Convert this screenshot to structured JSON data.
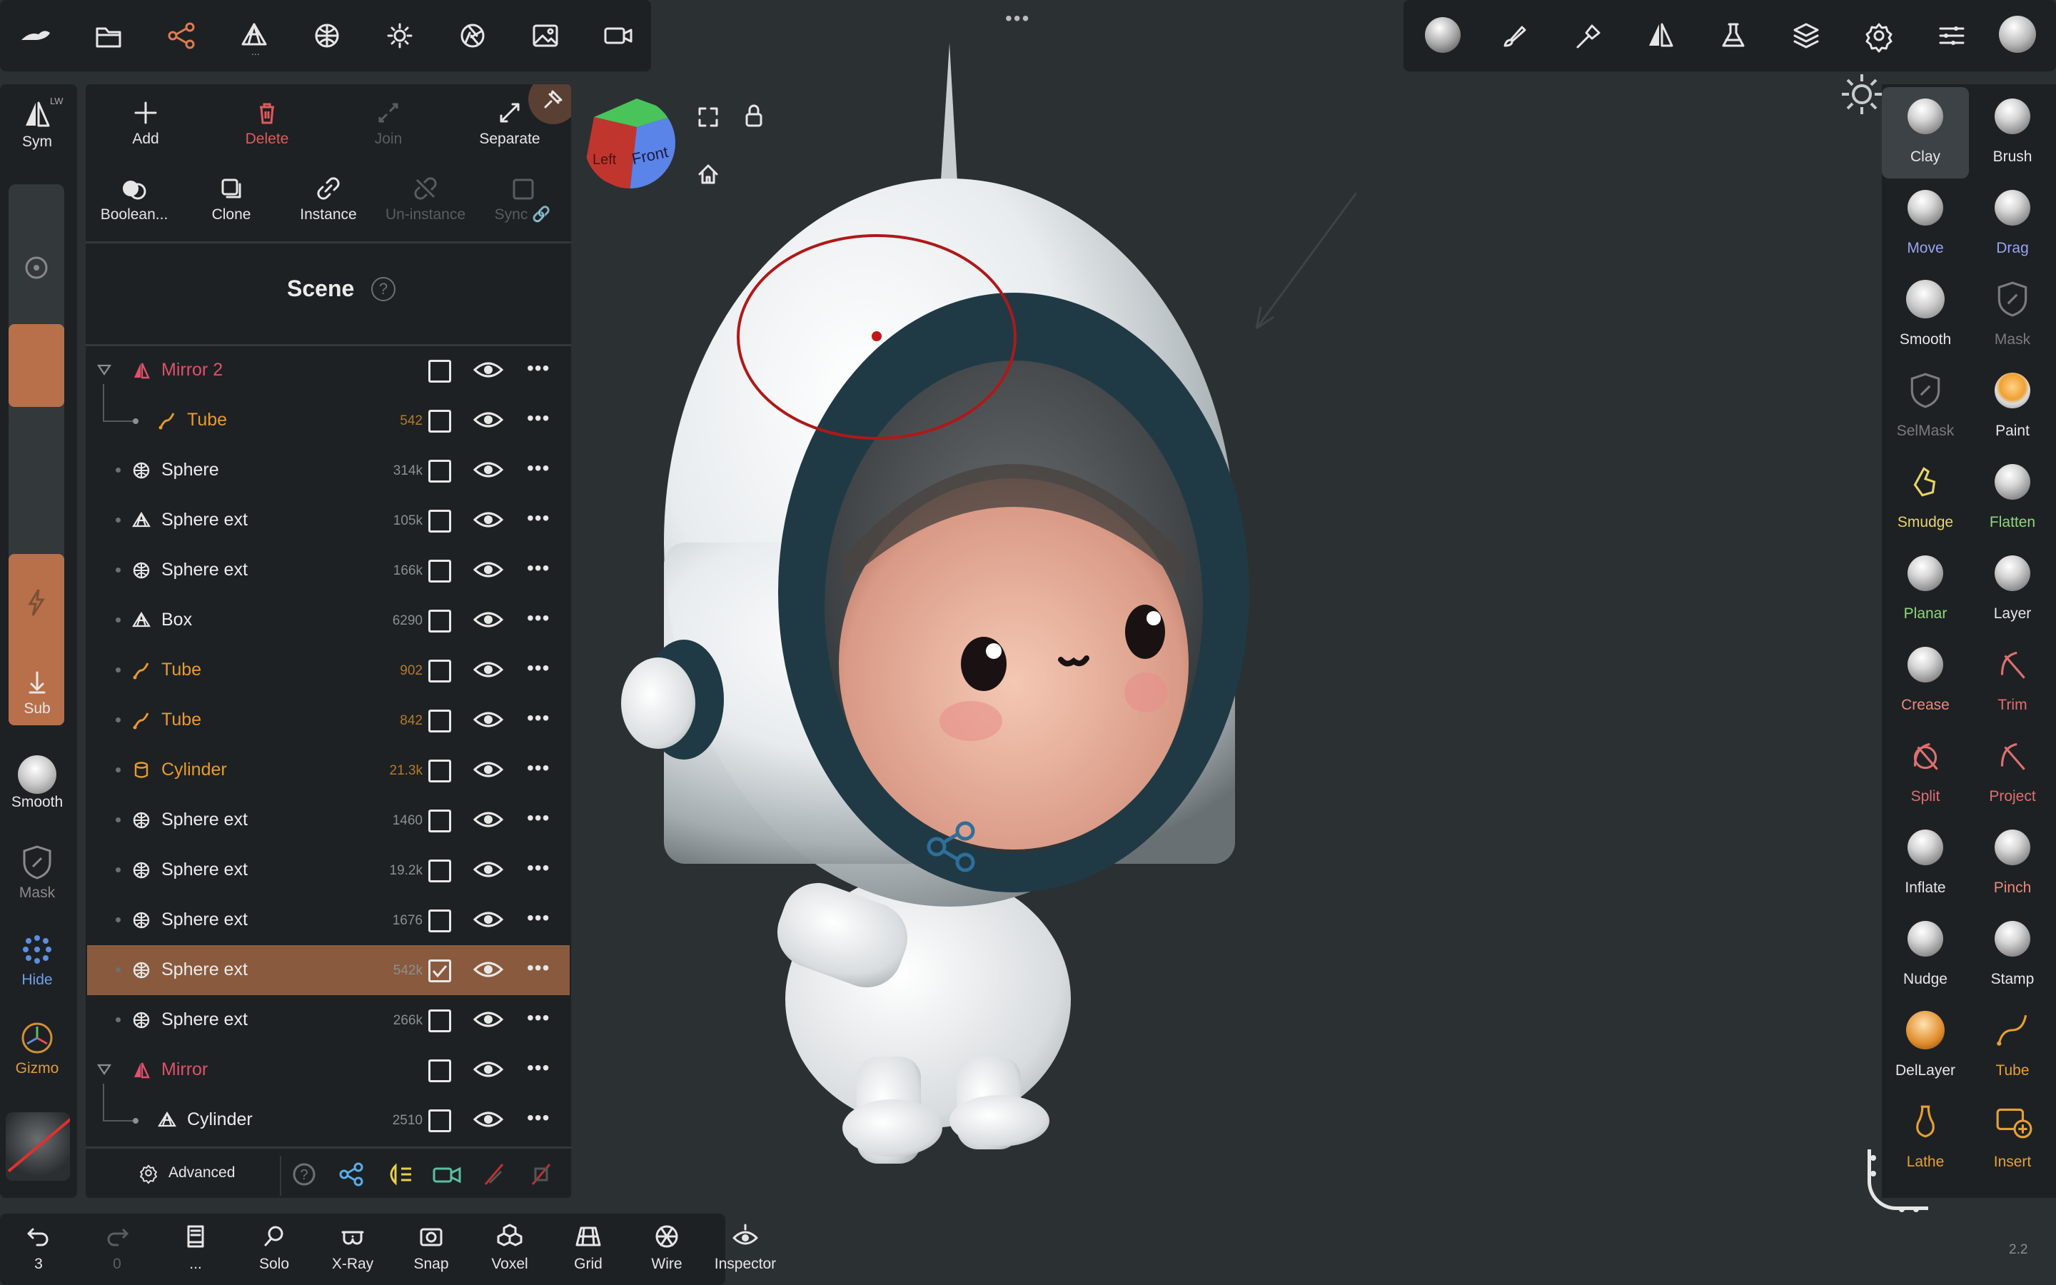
{
  "top_toolbar": {
    "left_icons": [
      "app-logo-icon",
      "folder-icon",
      "scene-graph-icon",
      "topology-icon",
      "material-sphere-icon",
      "light-sun-icon",
      "aperture-icon",
      "image-icon",
      "camera-video-icon"
    ],
    "more_dots": "•••",
    "right_icons": [
      "material-ball-icon",
      "paint-brush-icon",
      "sculpt-brush-icon",
      "symmetry-icon",
      "flask-icon",
      "layers-icon",
      "settings-gear-icon",
      "sliders-icon",
      "sphere-preview-icon"
    ]
  },
  "left_strip": {
    "sym_label": "Sym",
    "sym_sub": "LW",
    "sub_label": "Sub",
    "smooth_label": "Smooth",
    "mask_label": "Mask",
    "hide_label": "Hide",
    "gizmo_label": "Gizmo",
    "swatch_color": "#b8704a"
  },
  "scene_panel": {
    "actions": [
      {
        "label": "Add",
        "icon": "plus-icon",
        "enabled": true
      },
      {
        "label": "Delete",
        "icon": "trash-icon",
        "enabled": true
      },
      {
        "label": "Join",
        "icon": "join-icon",
        "enabled": false
      },
      {
        "label": "Separate",
        "icon": "separate-icon",
        "enabled": true
      },
      {
        "label": "Boolean...",
        "icon": "boolean-icon",
        "enabled": true
      },
      {
        "label": "Clone",
        "icon": "clone-icon",
        "enabled": true
      },
      {
        "label": "Instance",
        "icon": "link-icon",
        "enabled": true
      },
      {
        "label": "Un-instance",
        "icon": "unlink-icon",
        "enabled": false
      },
      {
        "label": "Sync 🔗",
        "icon": "sync-checkbox-icon",
        "enabled": false
      }
    ],
    "title": "Scene",
    "help": "?",
    "rows": [
      {
        "name": "Mirror 2",
        "count": "",
        "kind": "mirror",
        "style": "red",
        "checked": false,
        "indent": 0,
        "expander": true
      },
      {
        "name": "Tube",
        "count": "542",
        "kind": "tube",
        "style": "orange",
        "checked": false,
        "indent": 1
      },
      {
        "name": "Sphere",
        "count": "314k",
        "kind": "sphere",
        "style": "normal",
        "checked": false,
        "indent": 0
      },
      {
        "name": "Sphere ext",
        "count": "105k",
        "kind": "mesh",
        "style": "normal",
        "checked": false,
        "indent": 0
      },
      {
        "name": "Sphere ext",
        "count": "166k",
        "kind": "sphere",
        "style": "normal",
        "checked": false,
        "indent": 0
      },
      {
        "name": "Box",
        "count": "6290",
        "kind": "mesh",
        "style": "normal",
        "checked": false,
        "indent": 0
      },
      {
        "name": "Tube",
        "count": "902",
        "kind": "tube",
        "style": "orange",
        "checked": false,
        "indent": 0
      },
      {
        "name": "Tube",
        "count": "842",
        "kind": "tube",
        "style": "orange",
        "checked": false,
        "indent": 0
      },
      {
        "name": "Cylinder",
        "count": "21.3k",
        "kind": "cylinder",
        "style": "orange",
        "checked": false,
        "indent": 0
      },
      {
        "name": "Sphere ext",
        "count": "1460",
        "kind": "sphere",
        "style": "normal",
        "checked": false,
        "indent": 0
      },
      {
        "name": "Sphere ext",
        "count": "19.2k",
        "kind": "sphere",
        "style": "normal",
        "checked": false,
        "indent": 0
      },
      {
        "name": "Sphere ext",
        "count": "1676",
        "kind": "sphere",
        "style": "normal",
        "checked": false,
        "indent": 0
      },
      {
        "name": "Sphere ext",
        "count": "542k",
        "kind": "sphere",
        "style": "selected",
        "checked": true,
        "indent": 0
      },
      {
        "name": "Sphere ext",
        "count": "266k",
        "kind": "sphere",
        "style": "normal",
        "checked": false,
        "indent": 0
      },
      {
        "name": "Mirror",
        "count": "",
        "kind": "mirror",
        "style": "red",
        "checked": false,
        "indent": 0,
        "expander": true
      },
      {
        "name": "Cylinder",
        "count": "2510",
        "kind": "mesh",
        "style": "normal",
        "checked": false,
        "indent": 1
      }
    ],
    "footer": {
      "advanced_label": "Advanced",
      "icons": [
        "help-circle-icon",
        "share-nodes-icon",
        "light-icon",
        "camera-icon",
        "no-mask-icon",
        "no-brush-icon"
      ]
    }
  },
  "viewport": {
    "cube_labels": {
      "front": "Front",
      "left": "Left"
    },
    "icons": [
      "fullscreen-icon",
      "lock-icon",
      "home-icon",
      "sun-light-icon",
      "share-nodes-icon"
    ],
    "version": "2.2"
  },
  "right_tools": [
    {
      "label": "Clay",
      "color": "#e6e6e6",
      "active": true
    },
    {
      "label": "Brush",
      "color": "#e6e6e6"
    },
    {
      "label": "Move",
      "color": "#9aa2f0"
    },
    {
      "label": "Drag",
      "color": "#9aa2f0"
    },
    {
      "label": "Smooth",
      "color": "#e6e6e6"
    },
    {
      "label": "Mask",
      "color": "#7b7b7b"
    },
    {
      "label": "SelMask",
      "color": "#7b7b7b"
    },
    {
      "label": "Paint",
      "color": "#e6e6e6"
    },
    {
      "label": "Smudge",
      "color": "#e8d468"
    },
    {
      "label": "Flatten",
      "color": "#8fd67b"
    },
    {
      "label": "Planar",
      "color": "#8fd67b"
    },
    {
      "label": "Layer",
      "color": "#e6e6e6"
    },
    {
      "label": "Crease",
      "color": "#e98a7a"
    },
    {
      "label": "Trim",
      "color": "#e06f6f"
    },
    {
      "label": "Split",
      "color": "#e06f6f"
    },
    {
      "label": "Project",
      "color": "#e06f6f"
    },
    {
      "label": "Inflate",
      "color": "#e6e6e6"
    },
    {
      "label": "Pinch",
      "color": "#e98a7a"
    },
    {
      "label": "Nudge",
      "color": "#e6e6e6"
    },
    {
      "label": "Stamp",
      "color": "#e6e6e6"
    },
    {
      "label": "DelLayer",
      "color": "#e6e6e6"
    },
    {
      "label": "Tube",
      "color": "#e8a030"
    },
    {
      "label": "Lathe",
      "color": "#e8a030"
    },
    {
      "label": "Insert",
      "color": "#e8a030"
    }
  ],
  "bottom_bar": [
    {
      "label": "3",
      "icon": "undo-icon",
      "enabled": true
    },
    {
      "label": "0",
      "icon": "redo-icon",
      "enabled": false
    },
    {
      "label": "...",
      "icon": "book-icon",
      "enabled": true
    },
    {
      "label": "Solo",
      "icon": "search-icon",
      "enabled": true
    },
    {
      "label": "X-Ray",
      "icon": "xray-glasses-icon",
      "enabled": true
    },
    {
      "label": "Snap",
      "icon": "snap-camera-icon",
      "enabled": true
    },
    {
      "label": "Voxel",
      "icon": "voxel-icon",
      "enabled": true
    },
    {
      "label": "Grid",
      "icon": "grid-icon",
      "enabled": true
    },
    {
      "label": "Wire",
      "icon": "wireframe-icon",
      "enabled": true
    },
    {
      "label": "Inspector",
      "icon": "inspector-eye-icon",
      "enabled": true
    }
  ]
}
